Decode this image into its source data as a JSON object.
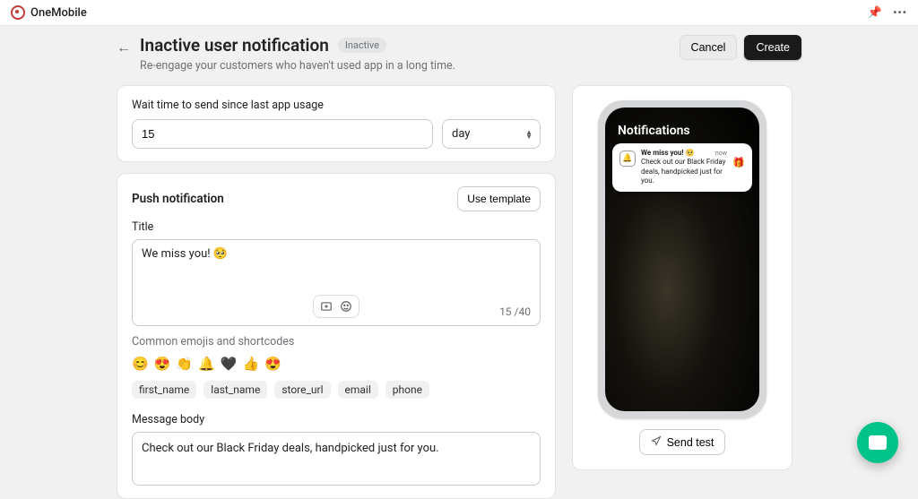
{
  "topbar": {
    "brand": "OneMobile"
  },
  "header": {
    "title": "Inactive user notification",
    "status": "Inactive",
    "subtitle": "Re-engage your customers who haven't used app in a long time.",
    "cancel": "Cancel",
    "create": "Create"
  },
  "wait_card": {
    "label": "Wait time to send since last app usage",
    "value": "15",
    "unit": "day"
  },
  "push": {
    "section_title": "Push notification",
    "use_template": "Use template",
    "title_label": "Title",
    "title_value": "We miss you! 🥺",
    "char_used": "15",
    "char_limit": "40",
    "emoji_hint": "Common emojis and shortcodes",
    "emojis": [
      "😊",
      "😍",
      "👏",
      "🔔",
      "🖤",
      "👍",
      "😍"
    ],
    "shortcodes": [
      "first_name",
      "last_name",
      "store_url",
      "email",
      "phone"
    ],
    "body_label": "Message body",
    "body_value": "Check out our Black Friday deals, handpicked just for you."
  },
  "preview": {
    "header": "Notifications",
    "title": "We miss you! 🥺",
    "body": "Check out our Black Friday deals, handpicked just for you.",
    "time": "now",
    "send_test": "Send test"
  }
}
